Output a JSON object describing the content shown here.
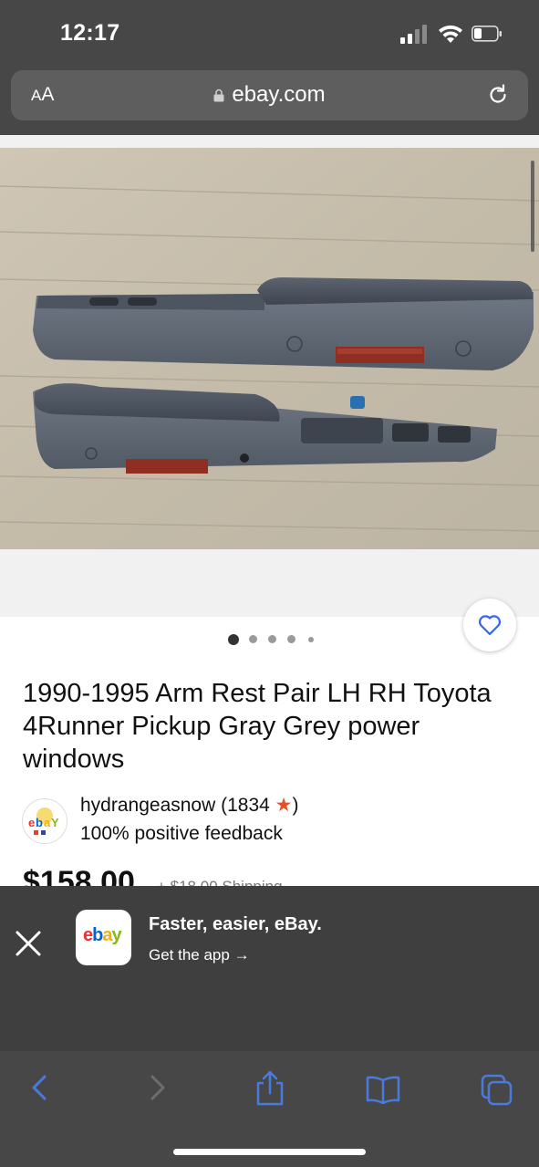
{
  "status_bar": {
    "time": "12:17"
  },
  "browser": {
    "text_size_label_small": "A",
    "text_size_label_large": "A",
    "domain": "ebay.com"
  },
  "gallery": {
    "image_count": 5,
    "active_index": 0
  },
  "listing": {
    "title": "1990-1995 Arm Rest Pair LH RH Toyota 4Runner Pickup Gray Grey power windows",
    "seller_name": "hydrangeasnow",
    "seller_score_prefix": "(1834 ",
    "seller_score_star": "★",
    "seller_score_suffix": ")",
    "seller_feedback": "100% positive feedback",
    "price_partial": "$158.00",
    "shipping_partial": "+ $18.00 Shipping"
  },
  "app_banner": {
    "app_logo_text": "ebay",
    "title": "Faster, easier, eBay.",
    "cta": "Get the app",
    "cta_arrow": "→"
  },
  "colors": {
    "chrome": "#474747",
    "toolbar_icons": "#4a7bdc",
    "favorite_icon": "#3665f3",
    "ebay_red": "#e53238",
    "ebay_blue": "#0064d2",
    "ebay_yellow": "#f5af02",
    "ebay_green": "#86b817"
  }
}
